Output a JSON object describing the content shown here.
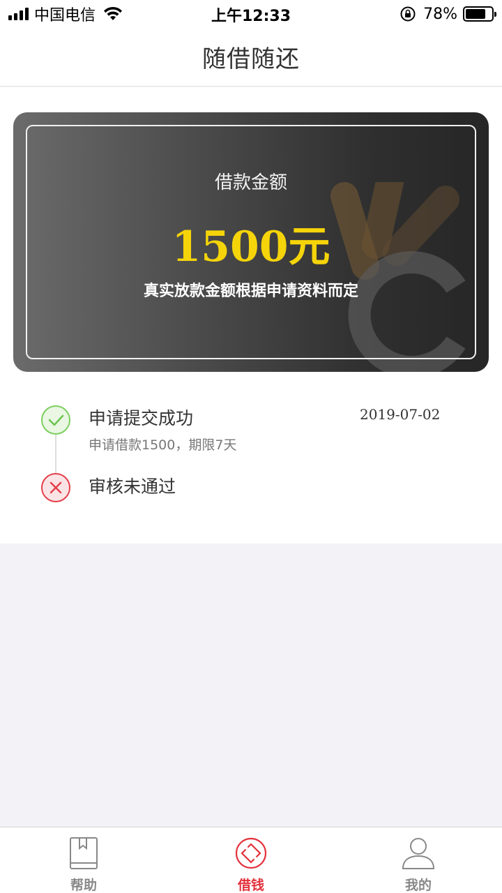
{
  "status_bar": {
    "carrier": "中国电信",
    "time": "上午12:33",
    "battery": "78%",
    "battery_level": 0.78
  },
  "nav": {
    "title": "随借随还"
  },
  "loan_card": {
    "label": "借款金额",
    "amount": "1500元",
    "note": "真实放款金额根据申请资料而定",
    "amount_color": "#f5d40a"
  },
  "timeline": [
    {
      "title": "申请提交成功",
      "subtitle": "申请借款1500，期限7天",
      "date": "2019-07-02",
      "status_icon": "check-circle-icon",
      "color": "#7ccf5e"
    },
    {
      "title": "审核未通过",
      "status_icon": "x-circle-icon",
      "color": "#e4404b"
    }
  ],
  "tab_bar": {
    "active_color": "#e2303b",
    "tabs": [
      {
        "label": "帮助",
        "icon": "book-icon",
        "active": false
      },
      {
        "label": "借钱",
        "icon": "diamond-icon",
        "active": true
      },
      {
        "label": "我的",
        "icon": "user-icon",
        "active": false
      }
    ]
  }
}
